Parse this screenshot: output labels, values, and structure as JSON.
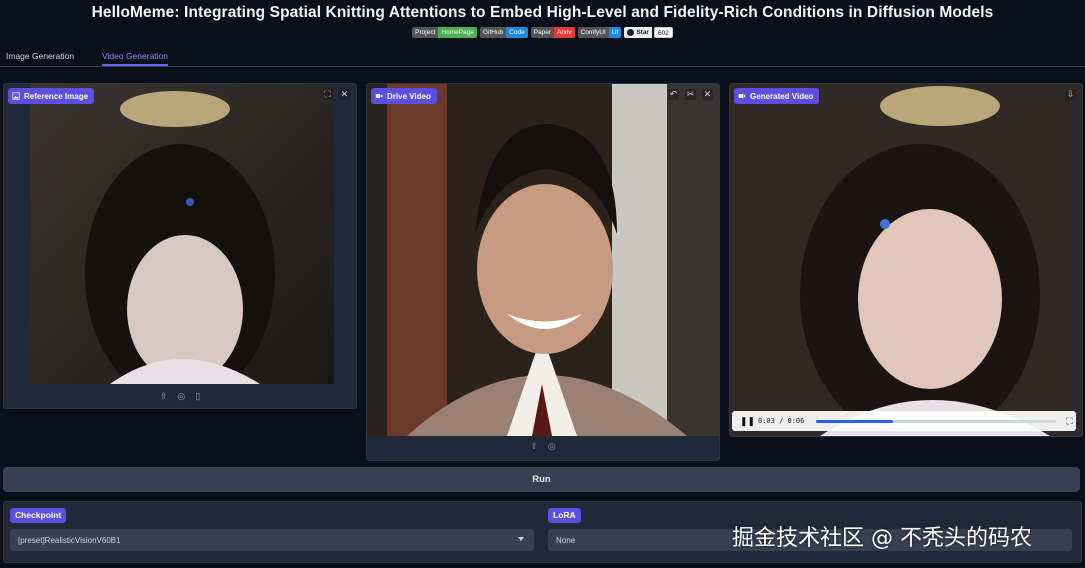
{
  "title": "HelloMeme: Integrating Spatial Knitting Attentions to Embed High-Level and Fidelity-Rich Conditions in Diffusion Models",
  "badges": [
    {
      "left": "Project",
      "right": "HomePage",
      "color": "#4caf50"
    },
    {
      "left": "GitHub",
      "right": "Code",
      "color": "#1e88e5"
    },
    {
      "left": "Paper",
      "right": "Arxiv",
      "color": "#e53935"
    },
    {
      "left": "ComfyUI",
      "right": "UI",
      "color": "#1e88e5"
    }
  ],
  "github_star": {
    "label": "Star",
    "count": "602"
  },
  "tabs": [
    {
      "label": "Image Generation",
      "active": false
    },
    {
      "label": "Video Generation",
      "active": true
    }
  ],
  "panels": {
    "reference": {
      "label": "Reference Image"
    },
    "drive": {
      "label": "Drive Video"
    },
    "generated": {
      "label": "Generated Video",
      "time": "0:03 / 0:06",
      "progress": 0.32
    }
  },
  "run_label": "Run",
  "checkpoint": {
    "label": "Checkpoint",
    "value": "[preset]RealisticVisionV60B1"
  },
  "lora": {
    "label": "LoRA",
    "value": "None"
  },
  "watermark": "掘金技术社区 @ 不秃头的码农",
  "colors": {
    "accent": "#5b4fe0",
    "background": "#0b0f19",
    "panel": "#1f2937"
  }
}
